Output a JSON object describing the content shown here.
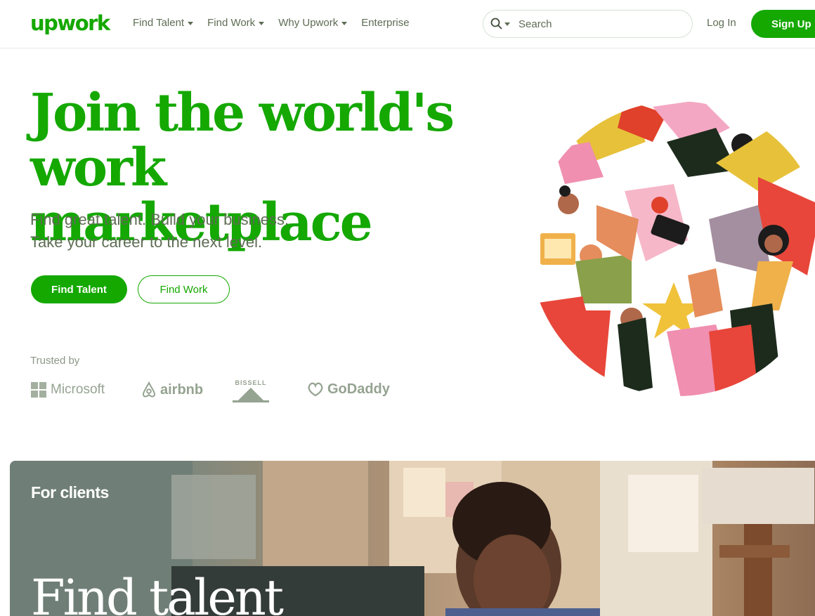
{
  "header": {
    "logo": "upwork",
    "nav": [
      {
        "label": "Find Talent",
        "has_caret": true
      },
      {
        "label": "Find Work",
        "has_caret": true
      },
      {
        "label": "Why Upwork",
        "has_caret": true
      },
      {
        "label": "Enterprise",
        "has_caret": false
      }
    ],
    "search_placeholder": "Search",
    "login": "Log In",
    "signup": "Sign Up"
  },
  "hero": {
    "title_line1": "Join the world's",
    "title_line2": "work marketplace",
    "subtitle_line1": "Find great talent. Build your business.",
    "subtitle_line2": "Take your career to the next level.",
    "btn_primary": "Find Talent",
    "btn_secondary": "Find Work"
  },
  "trusted": {
    "label": "Trusted by",
    "brands": [
      "Microsoft",
      "airbnb",
      "BISSELL",
      "GoDaddy"
    ]
  },
  "clients": {
    "label": "For clients",
    "title": "Find talent"
  },
  "colors": {
    "brand_green": "#14a800",
    "text_muted": "#5e6d55",
    "logo_gray": "#95a391"
  }
}
